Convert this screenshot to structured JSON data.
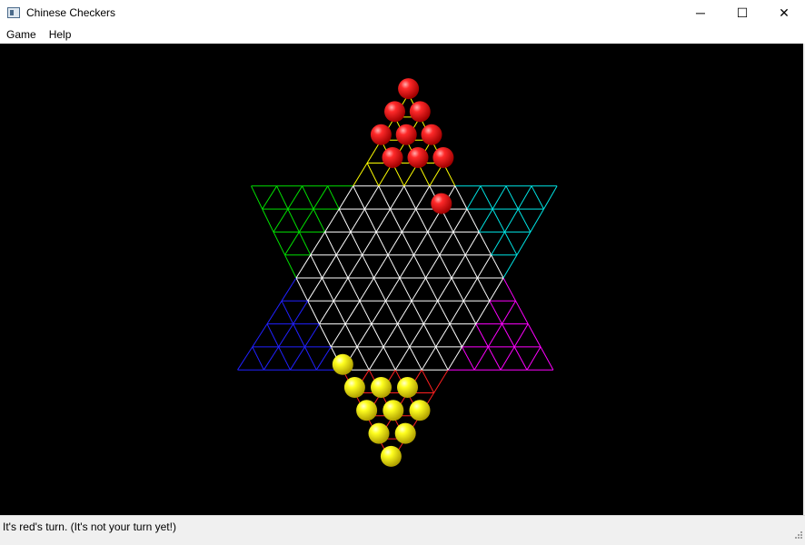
{
  "window": {
    "title": "Chinese Checkers",
    "minimize_glyph": "─",
    "maximize_glyph": "☐",
    "close_glyph": "✕"
  },
  "menu": {
    "items": [
      {
        "label": "Game"
      },
      {
        "label": "Help"
      }
    ]
  },
  "status": {
    "text": "It's red's turn.  (It's not your turn yet!)"
  },
  "board": {
    "colors": {
      "background": "#000000",
      "grid": "#ffffff",
      "top_triangle": "#ffff00",
      "top_left_triangle": "#2020ff",
      "top_right_triangle": "#ff00ff",
      "bottom_left_triangle": "#00e000",
      "bottom_right_triangle": "#00e5e5",
      "bottom_triangle": "#ff2020",
      "red_piece": "#ff1a1a",
      "yellow_piece": "#ffff00"
    },
    "current_turn": "red"
  }
}
